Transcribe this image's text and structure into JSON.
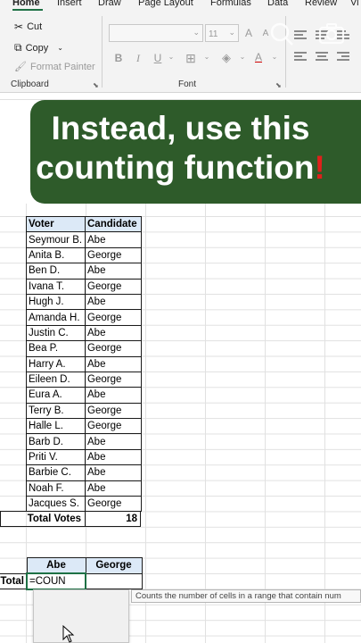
{
  "ribbon": {
    "tabs": [
      "Home",
      "Insert",
      "Draw",
      "Page Layout",
      "Formulas",
      "Data",
      "Review",
      "Vi"
    ],
    "active_tab": "Home",
    "clipboard": {
      "cut": "Cut",
      "copy": "Copy",
      "format_painter": "Format Painter",
      "group_label": "Clipboard"
    },
    "font": {
      "font_name": "",
      "font_size": "11",
      "bold": "B",
      "italic": "I",
      "underline": "U",
      "grow": "A",
      "shrink": "A",
      "font_color": "A",
      "group_label": "Font"
    }
  },
  "banner": {
    "line1": "Instead, use this",
    "line2": "counting function",
    "mark": "!"
  },
  "table": {
    "headers": [
      "Voter",
      "Candidate"
    ],
    "rows": [
      [
        "Seymour B.",
        "Abe"
      ],
      [
        "Anita B.",
        "George"
      ],
      [
        "Ben D.",
        "Abe"
      ],
      [
        "Ivana T.",
        "George"
      ],
      [
        "Hugh J.",
        "Abe"
      ],
      [
        "Amanda H.",
        "George"
      ],
      [
        "Justin C.",
        "Abe"
      ],
      [
        "Bea P.",
        "George"
      ],
      [
        "Harry A.",
        "Abe"
      ],
      [
        "Eileen D.",
        "George"
      ],
      [
        "Eura A.",
        "Abe"
      ],
      [
        "Terry B.",
        "George"
      ],
      [
        "Halle L.",
        "George"
      ],
      [
        "Barb D.",
        "Abe"
      ],
      [
        "Priti V.",
        "Abe"
      ],
      [
        "Barbie C.",
        "Abe"
      ],
      [
        "Noah F.",
        "Abe"
      ],
      [
        "Jacques S.",
        "George"
      ]
    ],
    "total_label": "Total Votes",
    "total_value": "18"
  },
  "summary": {
    "headers": [
      "Abe",
      "George"
    ],
    "row_label": "Total",
    "formula": "=COUN",
    "george_value": ""
  },
  "tooltip": "Counts the number of cells in a range that contain num",
  "colors": {
    "banner_bg": "#2e5b2a",
    "header_fill": "#dce9f7",
    "accent": "#1e7145",
    "exclamation": "#e0201b"
  }
}
